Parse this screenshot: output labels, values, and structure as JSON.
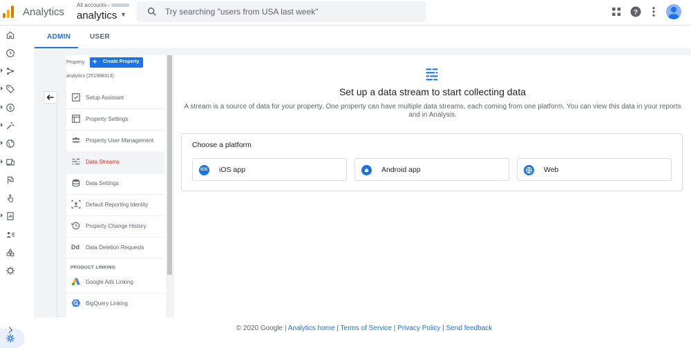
{
  "app": {
    "name": "Analytics",
    "account_crumb": "All accounts",
    "account_name": "analytics"
  },
  "search": {
    "placeholder": "Try searching \"users from USA last week\""
  },
  "tabs": [
    {
      "label": "ADMIN",
      "active": true
    },
    {
      "label": "USER",
      "active": false
    }
  ],
  "property": {
    "label": "Property",
    "create_label": "Create Property",
    "id_text": "analytics (251968313)",
    "menu": [
      {
        "label": "Setup Assistant",
        "icon": "checklist-icon"
      },
      {
        "label": "Property Settings",
        "icon": "settings-page-icon"
      },
      {
        "label": "Property User Management",
        "icon": "people-icon"
      },
      {
        "label": "Data Streams",
        "icon": "data-streams-icon",
        "selected": true
      },
      {
        "label": "Data Settings",
        "icon": "database-icon"
      },
      {
        "label": "Default Reporting Identity",
        "icon": "identity-icon"
      },
      {
        "label": "Property Change History",
        "icon": "history-icon"
      },
      {
        "label": "Data Deletion Requests",
        "icon": "dd-icon"
      }
    ],
    "section_product_linking": "PRODUCT LINKING",
    "linking": [
      {
        "label": "Google Ads Linking",
        "icon": "google-ads-icon"
      },
      {
        "label": "BigQuery Linking",
        "icon": "bigquery-icon"
      }
    ]
  },
  "main": {
    "title": "Set up a data stream to start collecting data",
    "description": "A stream is a source of data for your property. One property can have multiple data streams, each coming from one platform. You can view this data in your reports and in Analysis.",
    "choose_label": "Choose a platform",
    "platforms": [
      {
        "label": "iOS app",
        "icon": "ios-icon"
      },
      {
        "label": "Android app",
        "icon": "android-icon"
      },
      {
        "label": "Web",
        "icon": "globe-icon"
      }
    ]
  },
  "footer": {
    "copyright": "© 2020 Google |",
    "links": [
      "Analytics home",
      "Terms of Service",
      "Privacy Policy",
      "Send feedback"
    ]
  },
  "colors": {
    "accent": "#1a73e8",
    "selected_text": "#d93025",
    "background": "#f1f3f4"
  }
}
